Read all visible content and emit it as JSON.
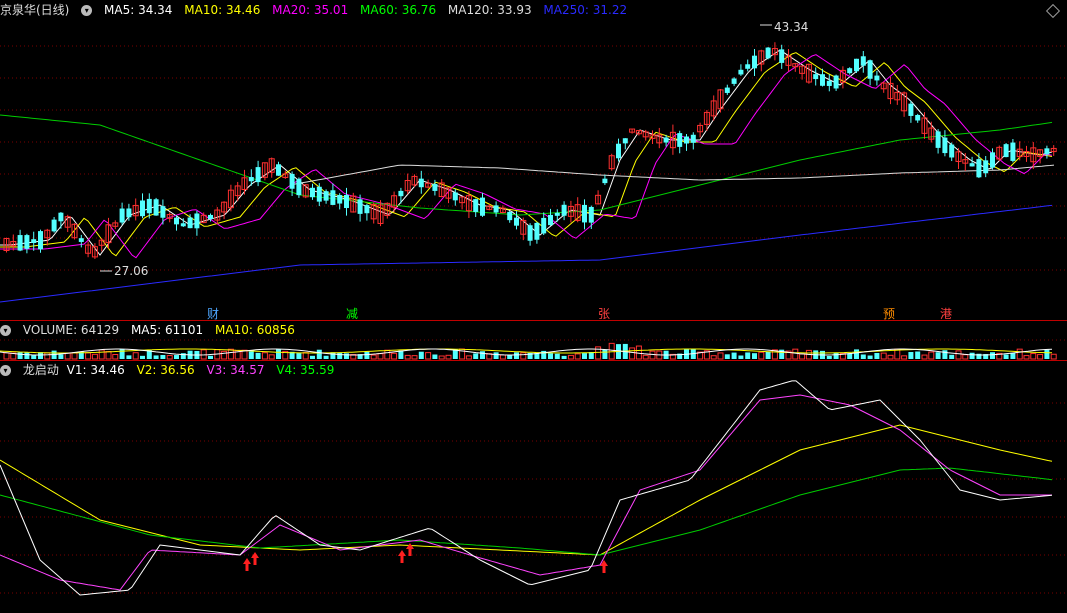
{
  "main": {
    "title": "京泉华(日线)",
    "ma": [
      {
        "label": "MA5: 34.34",
        "color": "#ffffff"
      },
      {
        "label": "MA10: 34.46",
        "color": "#ffff00"
      },
      {
        "label": "MA20: 35.01",
        "color": "#ff00ff"
      },
      {
        "label": "MA60: 36.76",
        "color": "#00ff00"
      },
      {
        "label": "MA120: 33.93",
        "color": "#dddddd"
      },
      {
        "label": "MA250: 31.22",
        "color": "#2a2aff"
      }
    ],
    "high_label": "43.34",
    "low_label": "27.06",
    "events": [
      {
        "text": "财",
        "color": "#4da6ff"
      },
      {
        "text": "减",
        "color": "#00ff00"
      },
      {
        "text": "张",
        "color": "#ff4040"
      },
      {
        "text": "预",
        "color": "#ff8c00"
      },
      {
        "text": "港",
        "color": "#ff4040"
      }
    ]
  },
  "volume": {
    "labels": [
      {
        "label": "VOLUME: 64129",
        "color": "#dddddd"
      },
      {
        "label": "MA5: 61101",
        "color": "#ffffff"
      },
      {
        "label": "MA10: 60856",
        "color": "#ffff00"
      }
    ]
  },
  "indicator": {
    "name": "龙启动",
    "labels": [
      {
        "label": "V1: 34.46",
        "color": "#ffffff"
      },
      {
        "label": "V2: 36.56",
        "color": "#ffff00"
      },
      {
        "label": "V3: 34.57",
        "color": "#ff44ff"
      },
      {
        "label": "V4: 35.59",
        "color": "#00ff00"
      }
    ]
  },
  "colors": {
    "up": "#ff3030",
    "down": "#54ffff",
    "grid": "#7a0000",
    "border": "#c00000"
  }
}
